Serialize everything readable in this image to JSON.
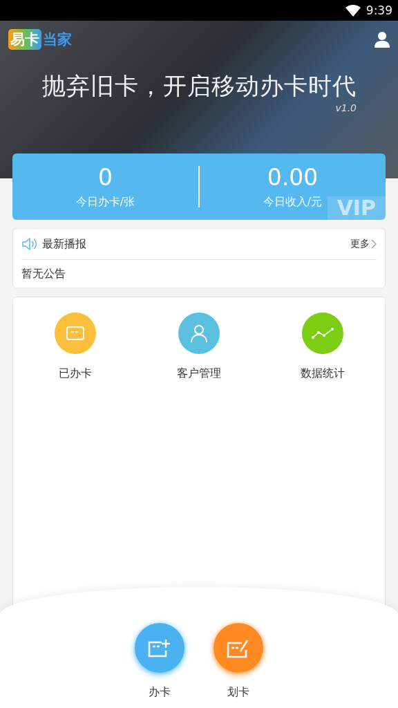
{
  "status_bar": {
    "time": "9:39"
  },
  "banner": {
    "logo": [
      "易卡",
      "当家"
    ],
    "slogan": "抛弃旧卡，开启移动办卡时代",
    "version": "v1.0"
  },
  "stats": [
    {
      "value": "0",
      "label": "今日办卡/张"
    },
    {
      "value": "0.00",
      "label": "今日收入/元"
    }
  ],
  "stats_watermark": "VIP",
  "notice": {
    "title": "最新播报",
    "more": "更多",
    "message": "暂无公告"
  },
  "menu": [
    {
      "kind": "card",
      "label": "已办卡",
      "color": "#fbbf3c"
    },
    {
      "kind": "person",
      "label": "客户管理",
      "color": "#5bbfe0"
    },
    {
      "kind": "chart",
      "label": "数据统计",
      "color": "#7ccd14"
    }
  ],
  "actions": [
    {
      "kind": "add",
      "label": "办卡",
      "color": "#4ab2f0"
    },
    {
      "kind": "swipe",
      "label": "划卡",
      "color": "#ff8a22"
    }
  ]
}
